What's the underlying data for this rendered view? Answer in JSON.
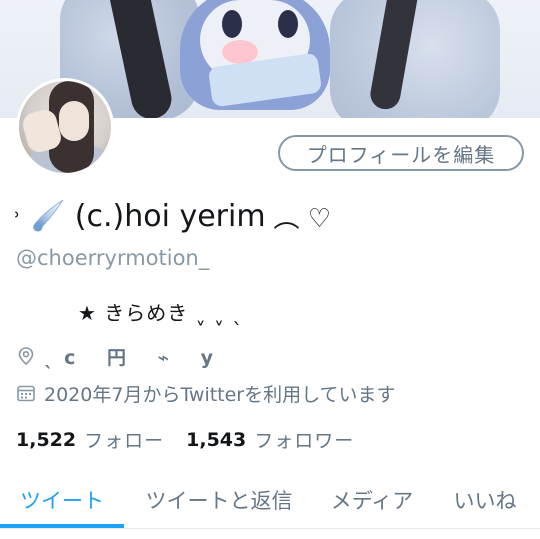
{
  "profile": {
    "edit_button_label": "プロフィールを編集",
    "name_prefix": "˒",
    "display_name": "(c.)hoi yerim",
    "name_suffix": "︵ ♡",
    "handle": "@choerryrmotion_",
    "bio": "★ きらめき ˬ ˬ ˎ",
    "location": "ˎ c　 円　 ⌁　 y",
    "joined": "2020年7月からTwitterを利用しています"
  },
  "stats": {
    "following_count": "1,522",
    "following_label": "フォロー",
    "followers_count": "1,543",
    "followers_label": "フォロワー"
  },
  "tabs": [
    {
      "label": "ツイート",
      "active": true
    },
    {
      "label": "ツイートと返信",
      "active": false
    },
    {
      "label": "メディア",
      "active": false
    },
    {
      "label": "いいね",
      "active": false
    }
  ],
  "colors": {
    "accent": "#1da1f2",
    "secondary_text": "#657786",
    "primary_text": "#14171a"
  },
  "icons": {
    "location": "location-pin-icon",
    "joined": "calendar-icon",
    "name_emoji": "comet-icon"
  }
}
